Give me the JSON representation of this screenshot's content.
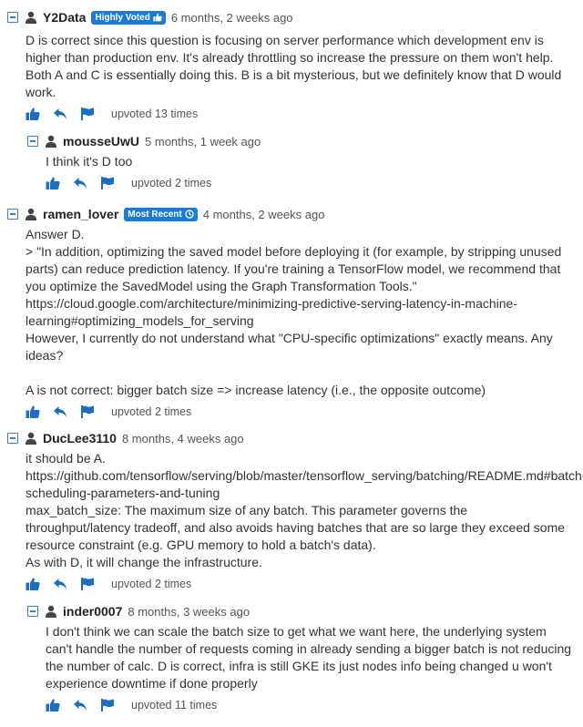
{
  "colors": {
    "accent": "#1d7bd8",
    "icon_blue": "#1b6ec2",
    "text": "#333333"
  },
  "comments": [
    {
      "username": "Y2Data",
      "badge": "Highly Voted",
      "badge_icon": "thumbs-up-icon",
      "time": "6 months, 2 weeks ago",
      "text": "D is correct since this question is focusing on server performance which development env is higher than production env. It's already throttling so increase the pressure on them won't help. Both A and C is essentially doing this. B is a bit mysterious, but we definitely know that D would work.",
      "votes": "upvoted 13 times"
    },
    {
      "username": "mousseUwU",
      "time": "5 months, 1 week ago",
      "text": "I think it's D too",
      "votes": "upvoted 2 times"
    },
    {
      "username": "ramen_lover",
      "badge": "Most Recent",
      "badge_icon": "clock-icon",
      "time": "4 months, 2 weeks ago",
      "text": "Answer D.\n> \"In addition, optimizing the saved model before deploying it (for example, by stripping unused parts) can reduce prediction latency. If you're training a TensorFlow model, we recommend that you optimize the SavedModel using the Graph Transformation Tools.\"\nhttps://cloud.google.com/architecture/minimizing-predictive-serving-latency-in-machine-learning#optimizing_models_for_serving\nHowever, I currently do not understand what \"CPU-specific optimizations\" exactly means. Any ideas?\n\nA is not correct: bigger batch size => increase latency (i.e., the opposite outcome)",
      "votes": "upvoted 2 times"
    },
    {
      "username": "DucLee3110",
      "time": "8 months, 4 weeks ago",
      "text": "it should be A.\nhttps://github.com/tensorflow/serving/blob/master/tensorflow_serving/batching/README.md#batch-scheduling-parameters-and-tuning\nmax_batch_size: The maximum size of any batch. This parameter governs the throughput/latency tradeoff, and also avoids having batches that are so large they exceed some resource constraint (e.g. GPU memory to hold a batch's data).\nAs with D, it will change the infrastructure.",
      "votes": "upvoted 2 times"
    },
    {
      "username": "inder0007",
      "time": "8 months, 3 weeks ago",
      "text": "I don't think we can scale the batch size to get what we want here, the underlying system can't handle the number of requests coming in already sending a bigger batch is not reducing the number of calc. D is correct, infra is still GKE its just nodes info being changed u won't experience downtime if done properly",
      "votes": "upvoted 11 times"
    }
  ]
}
